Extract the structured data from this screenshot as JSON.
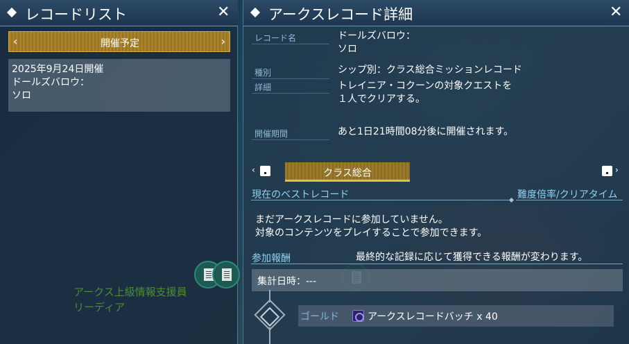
{
  "left_panel": {
    "title": "レコードリスト",
    "close_glyph": "✕",
    "category_selector": {
      "label": "開催予定",
      "prev_glyph": "‹",
      "next_glyph": "›"
    },
    "records": [
      {
        "line1": "2025年9月24日開催",
        "line2": "ドールズバロウ：",
        "line3": "ソロ"
      }
    ],
    "npc": {
      "name_line1": "アークス上級情報支援員",
      "name_line2": "リーディア"
    }
  },
  "right_panel": {
    "title": "アークスレコード詳細",
    "close_glyph": "✕",
    "fields": {
      "record_name": {
        "label": "レコード名",
        "value_line1": "ドールズバロウ：",
        "value_line2": "ソロ"
      },
      "type": {
        "label": "種別",
        "value": "シップ別：クラス総合ミッションレコード"
      },
      "detail": {
        "label": "詳細",
        "value_line1": "トレイニア・コクーンの対象クエストを",
        "value_line2": "１人でクリアする。"
      },
      "period": {
        "label": "開催期間",
        "value": "あと1日21時間08分後に開催されます。"
      }
    },
    "class_tab": {
      "label": "クラス総合",
      "prev_glyph": "‹",
      "next_glyph": "›"
    },
    "best_record": {
      "title": "現在のベストレコード",
      "right_title": "難度倍率/クリアタイム",
      "message_line1": "まだアークスレコードに参加していません。",
      "message_line2": "対象のコンテンツをプレイすることで参加できます。"
    },
    "rewards": {
      "title": "参加報酬",
      "note": "最終的な記録に応じて獲得できる報酬が変わります。",
      "aggregate": "集計日時：---",
      "tier": "ゴールド",
      "item": "アークスレコードバッチ x 40"
    }
  },
  "colors": {
    "accent_gold": "#e7c233",
    "label_blue": "#8fb8d4",
    "npc_green": "#4c8c34"
  },
  "icons": [
    "diamond-icon",
    "close-icon",
    "chevron-left-icon",
    "chevron-right-icon",
    "document-icon",
    "badge-icon"
  ]
}
